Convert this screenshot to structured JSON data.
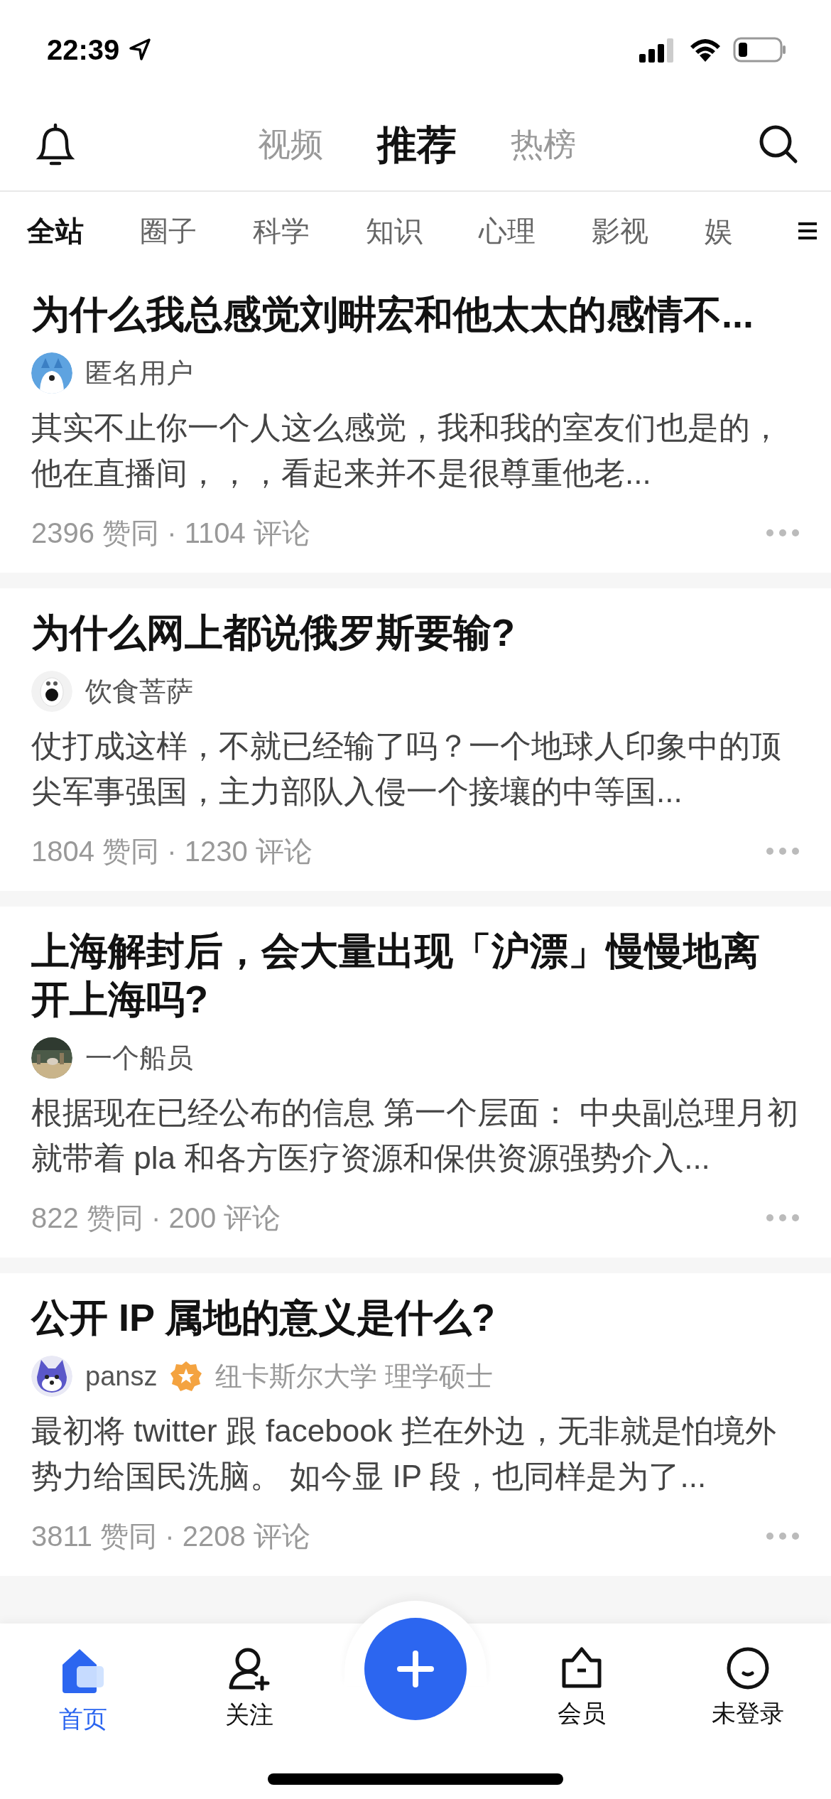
{
  "status_bar": {
    "time": "22:39"
  },
  "top_tabs": [
    {
      "label": "视频",
      "selected": false
    },
    {
      "label": "推荐",
      "selected": true
    },
    {
      "label": "热榜",
      "selected": false
    }
  ],
  "categories": [
    {
      "label": "全站",
      "selected": true
    },
    {
      "label": "圈子",
      "selected": false
    },
    {
      "label": "科学",
      "selected": false
    },
    {
      "label": "知识",
      "selected": false
    },
    {
      "label": "心理",
      "selected": false
    },
    {
      "label": "影视",
      "selected": false
    },
    {
      "label": "娱",
      "selected": false
    }
  ],
  "feed": [
    {
      "title": "为什么我总感觉刘畊宏和他太太的感情不...",
      "author": "匿名用户",
      "verified": false,
      "excerpt": "其实不止你一个人这么感觉，我和我的室友们也是的，他在直播间，，，看起来并不是很尊重他老...",
      "stats": "2396 赞同 · 1104 评论"
    },
    {
      "title": "为什么网上都说俄罗斯要输?",
      "author": "饮食菩萨",
      "verified": false,
      "excerpt": "仗打成这样，不就已经输了吗？一个地球人印象中的顶尖军事强国，主力部队入侵一个接壤的中等国...",
      "stats": "1804 赞同 · 1230 评论"
    },
    {
      "title": "上海解封后，会大量出现「沪漂」慢慢地离开上海吗?",
      "author": "一个船员",
      "verified": false,
      "excerpt": "根据现在已经公布的信息 第一个层面：  中央副总理月初就带着 pla 和各方医疗资源和保供资源强势介入...",
      "stats": "822 赞同 · 200 评论"
    },
    {
      "title": "公开 IP 属地的意义是什么?",
      "author": "pansz",
      "verified": true,
      "credential": "纽卡斯尔大学 理学硕士",
      "excerpt": "最初将 twitter 跟 facebook 拦在外边，无非就是怕境外势力给国民洗脑。 如今显 IP 段，也同样是为了...",
      "stats": "3811 赞同 · 2208 评论"
    }
  ],
  "bottom_nav": [
    {
      "label": "首页",
      "selected": true
    },
    {
      "label": "关注",
      "selected": false
    },
    {
      "label": "会员",
      "selected": false
    },
    {
      "label": "未登录",
      "selected": false
    }
  ]
}
